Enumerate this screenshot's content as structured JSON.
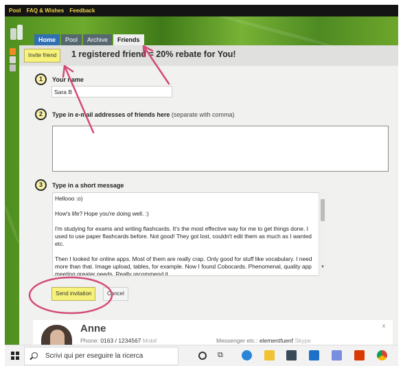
{
  "topnav": {
    "items": [
      "Pool",
      "FAQ & Wishes",
      "Feedback"
    ]
  },
  "tabs": [
    "Home",
    "Pool",
    "Archive",
    "Friends"
  ],
  "header": {
    "invite_label": "Invite friend",
    "rebate_text": "1 registered friend = 20% rebate for You!"
  },
  "form": {
    "step1": {
      "number": "1",
      "label": "Your name",
      "value": "Sara B"
    },
    "step2": {
      "number": "2",
      "label": "Type in e-mail addresses of friends here",
      "hint": "(separate with comma)",
      "value": ""
    },
    "step3": {
      "number": "3",
      "label": "Type in a short message",
      "lines": [
        "Hellooo :o)",
        "How's life? Hope you're doing well. :)",
        "I'm studying for exams and writing flashcards. It's the most effective way for me to get things done. I used to use paper flashcards before. Not good! They got lost, couldn't edit them as much as I wanted etc.",
        "Then I looked for online apps. Most of them are really crap. Only good for stuff like vocabulary. I need more than that. Image upload, tables, for example. Now I found Cobocards. Phenomenal, quality app meeting greater needs. Really recommend it."
      ]
    },
    "send_label": "Send invitation",
    "cancel_label": "Cancel"
  },
  "contact": {
    "name": "Anne",
    "phone_label": "Phone:",
    "phone_value": "0163 / 1234567",
    "phone_type": "Mobil",
    "messenger_label": "Messenger etc.:",
    "messenger_value": "elementfuenf",
    "messenger_type": "Skype",
    "close": "x"
  },
  "taskbar": {
    "search_text": "Scrivi qui per eseguire la ricerca"
  },
  "colors": {
    "annotation": "#d24a78",
    "highlight": "#f6f27a",
    "home_tab": "#2f6fb2"
  },
  "icons": [
    "windows-start-icon",
    "search-icon",
    "cortana-icon",
    "task-view-icon",
    "edge-icon",
    "file-explorer-icon",
    "store-icon",
    "mail-icon",
    "app-icon",
    "office-icon",
    "chrome-icon"
  ]
}
